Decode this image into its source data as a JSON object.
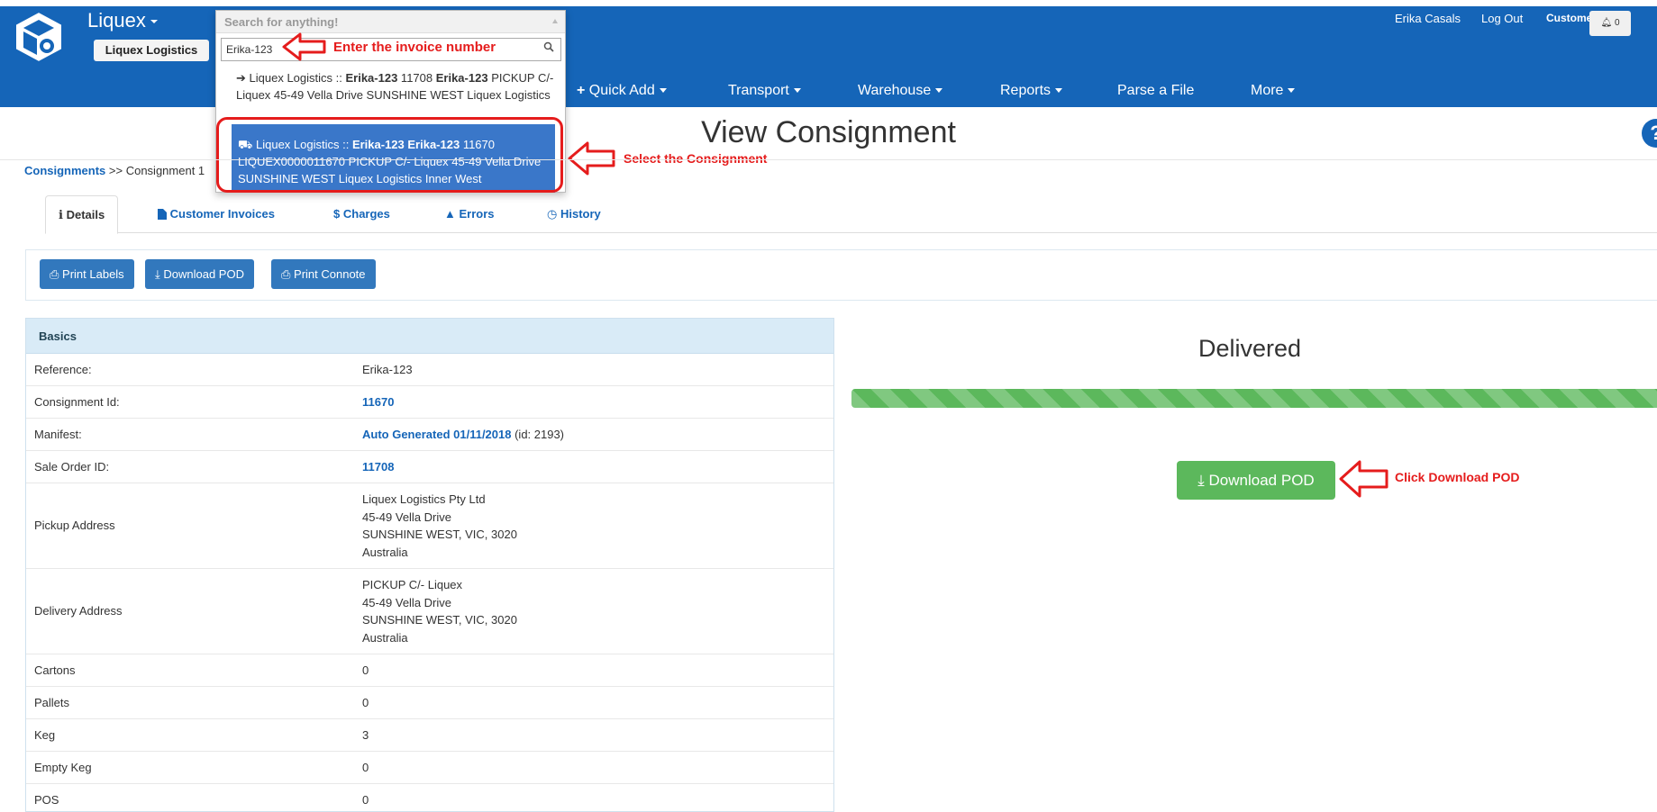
{
  "header": {
    "brand": "Liquex",
    "company": "Liquex Logistics",
    "nav": {
      "quick_add": "Quick Add",
      "transport": "Transport",
      "warehouse": "Warehouse",
      "reports": "Reports",
      "parse_file": "Parse a File",
      "more": "More"
    },
    "user": "Erika Casals",
    "logout": "Log Out",
    "role": "Customer",
    "notifications": "0"
  },
  "search": {
    "placeholder": "Search for anything!",
    "value": "Erika-123",
    "result1": {
      "prefix": "Liquex Logistics :: ",
      "ref": "Erika-123",
      "id": " 11708 ",
      "ref2": "Erika-123",
      "rest": "PICKUP C/- Liquex 45-49 Vella Drive SUNSHINE WEST Liquex Logistics"
    },
    "result2": {
      "prefix": "Liquex Logistics :: ",
      "ref": "Erika-123 Erika-123",
      "rest": " 11670 LIQUEX0000011670 PICKUP C/- Liquex 45-49 Vella Drive SUNSHINE WEST Liquex Logistics Inner West"
    }
  },
  "annotations": {
    "enter_invoice": "Enter the invoice number",
    "select_consignment": "Select the Consignment",
    "click_download": "Click Download POD"
  },
  "page": {
    "title": "View Consignment",
    "breadcrumb_link": "Consignments",
    "breadcrumb_rest": " >> Consignment 1"
  },
  "tabs": {
    "details": "Details",
    "customer_invoices": "Customer Invoices",
    "charges": "Charges",
    "errors": "Errors",
    "history": "History"
  },
  "actions": {
    "print_labels": "Print Labels",
    "download_pod": "Download POD",
    "print_connote": "Print Connote"
  },
  "basics": {
    "heading": "Basics",
    "reference_label": "Reference:",
    "reference_value": "Erika-123",
    "consignment_id_label": "Consignment Id:",
    "consignment_id_value": "11670",
    "manifest_label": "Manifest:",
    "manifest_link": "Auto Generated 01/11/2018",
    "manifest_suffix": " (id: 2193)",
    "sale_order_label": "Sale Order ID:",
    "sale_order_value": "11708",
    "pickup_label": "Pickup Address",
    "pickup_lines": [
      "Liquex Logistics Pty Ltd",
      "45-49 Vella Drive",
      "SUNSHINE WEST, VIC, 3020",
      "Australia"
    ],
    "delivery_label": "Delivery Address",
    "delivery_lines": [
      "PICKUP C/- Liquex",
      "45-49 Vella Drive",
      "SUNSHINE WEST, VIC, 3020",
      "Australia"
    ],
    "cartons_label": "Cartons",
    "cartons_value": "0",
    "pallets_label": "Pallets",
    "pallets_value": "0",
    "keg_label": "Keg",
    "keg_value": "3",
    "empty_keg_label": "Empty Keg",
    "empty_keg_value": "0",
    "pos_label": "POS",
    "pos_value": "0"
  },
  "status": {
    "label": "Delivered",
    "progress": 1.0,
    "download_button": "Download POD"
  },
  "colors": {
    "header_blue": "#1565b8",
    "success_green": "#5cb85c",
    "annotation_red": "#e51c1c",
    "button_blue": "#3278bd"
  }
}
